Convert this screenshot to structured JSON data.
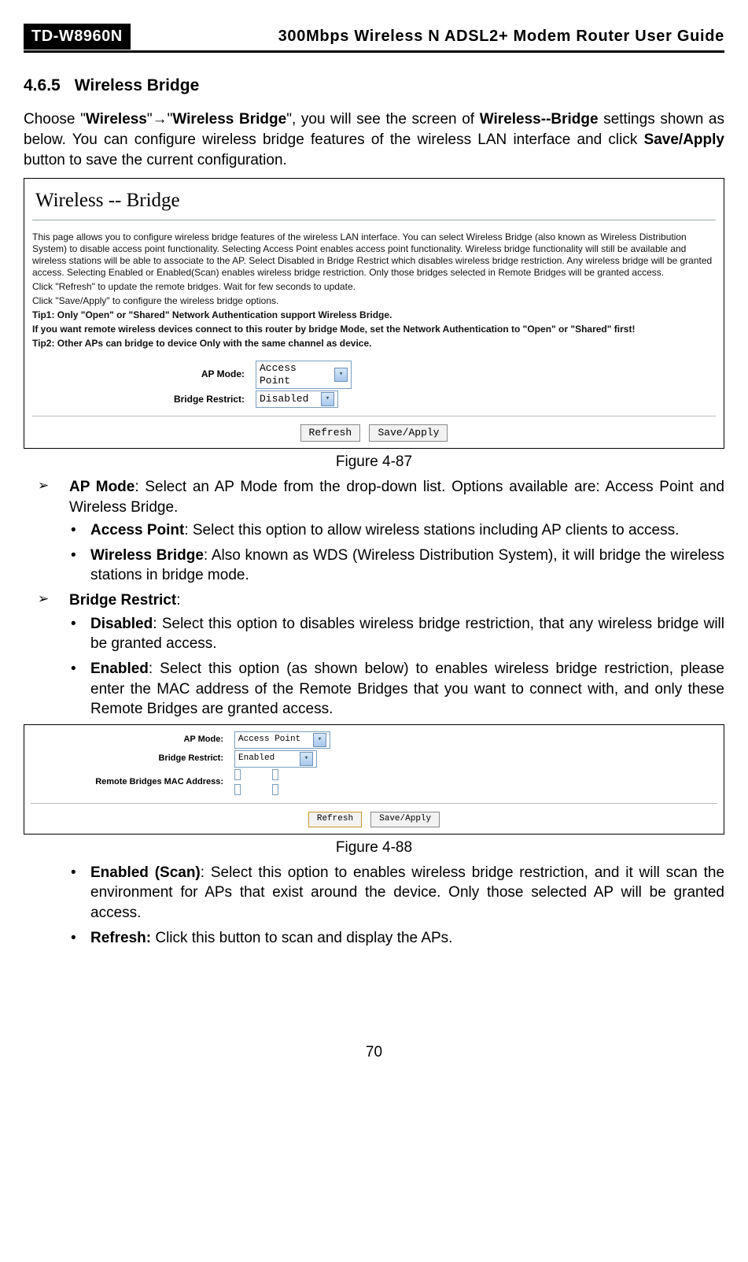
{
  "header": {
    "model": "TD-W8960N",
    "guide": "300Mbps Wireless N ADSL2+ Modem Router User Guide"
  },
  "section": {
    "number": "4.6.5",
    "title": "Wireless Bridge"
  },
  "intro": {
    "t1": "Choose \"",
    "b1": "Wireless",
    "t2": "\"→\"",
    "b2": "Wireless Bridge",
    "t3": "\", you will see the screen of ",
    "b3": "Wireless--Bridge",
    "t4": " settings shown as below. You can configure wireless bridge features of the wireless LAN interface and click ",
    "b4": "Save/Apply",
    "t5": " button to save the current configuration."
  },
  "figure87": {
    "title": "Wireless -- Bridge",
    "desc1": "This page allows you to configure wireless bridge features of the wireless LAN interface. You can select Wireless Bridge (also known as Wireless Distribution System) to disable access point functionality. Selecting Access Point enables access point functionality. Wireless bridge functionality will still be available and wireless stations will be able to associate to the AP. Select Disabled in Bridge Restrict which disables wireless bridge restriction. Any wireless bridge will be granted access. Selecting Enabled or Enabled(Scan) enables wireless bridge restriction. Only those bridges selected in Remote Bridges will be granted access.",
    "desc2": "Click \"Refresh\" to update the remote bridges. Wait for few seconds to update.",
    "desc3": "Click \"Save/Apply\" to configure the wireless bridge options.",
    "tip1": "Tip1: Only \"Open\" or \"Shared\" Network Authentication support Wireless Bridge.",
    "tip1b": "If you want remote wireless devices connect to this router by bridge Mode, set the Network Authentication to \"Open\" or \"Shared\" first!",
    "tip2": "Tip2: Other APs can bridge to device Only with the same channel as device.",
    "label_apmode": "AP Mode:",
    "value_apmode": "Access Point",
    "label_restrict": "Bridge Restrict:",
    "value_restrict": "Disabled",
    "btn_refresh": "Refresh",
    "btn_save": "Save/Apply",
    "caption": "Figure 4-87"
  },
  "list": {
    "apmode": {
      "head": "AP Mode",
      "text": ": Select an AP Mode from the drop-down list. Options available are: Access Point and Wireless Bridge."
    },
    "access_point": {
      "head": "Access Point",
      "text": ": Select this option to allow wireless stations including AP clients to access."
    },
    "wireless_bridge": {
      "head": "Wireless Bridge",
      "text": ": Also known as WDS (Wireless Distribution System), it will bridge the wireless stations in bridge mode."
    },
    "bridge_restrict": {
      "head": "Bridge Restrict",
      "text": ":"
    },
    "disabled": {
      "head": "Disabled",
      "text": ": Select this option to disables wireless bridge restriction, that any wireless bridge will be granted access."
    },
    "enabled": {
      "head": "Enabled",
      "text": ": Select this option (as shown below) to enables wireless bridge restriction, please enter the MAC address of the Remote Bridges that you want to connect with, and only these Remote Bridges are granted access."
    },
    "enabled_scan": {
      "head": "Enabled (Scan)",
      "text": ": Select this option to enables wireless bridge restriction, and it will scan the environment for APs that exist around the device. Only those selected AP will be granted access."
    },
    "refresh": {
      "head": "Refresh:",
      "text": " Click this button to scan and display the APs."
    }
  },
  "figure88": {
    "label_apmode": "AP Mode:",
    "value_apmode": "Access Point",
    "label_restrict": "Bridge Restrict:",
    "value_restrict": "Enabled",
    "label_mac": "Remote Bridges MAC Address:",
    "btn_refresh": "Refresh",
    "btn_save": "Save/Apply",
    "caption": "Figure 4-88"
  },
  "pagenum": "70"
}
